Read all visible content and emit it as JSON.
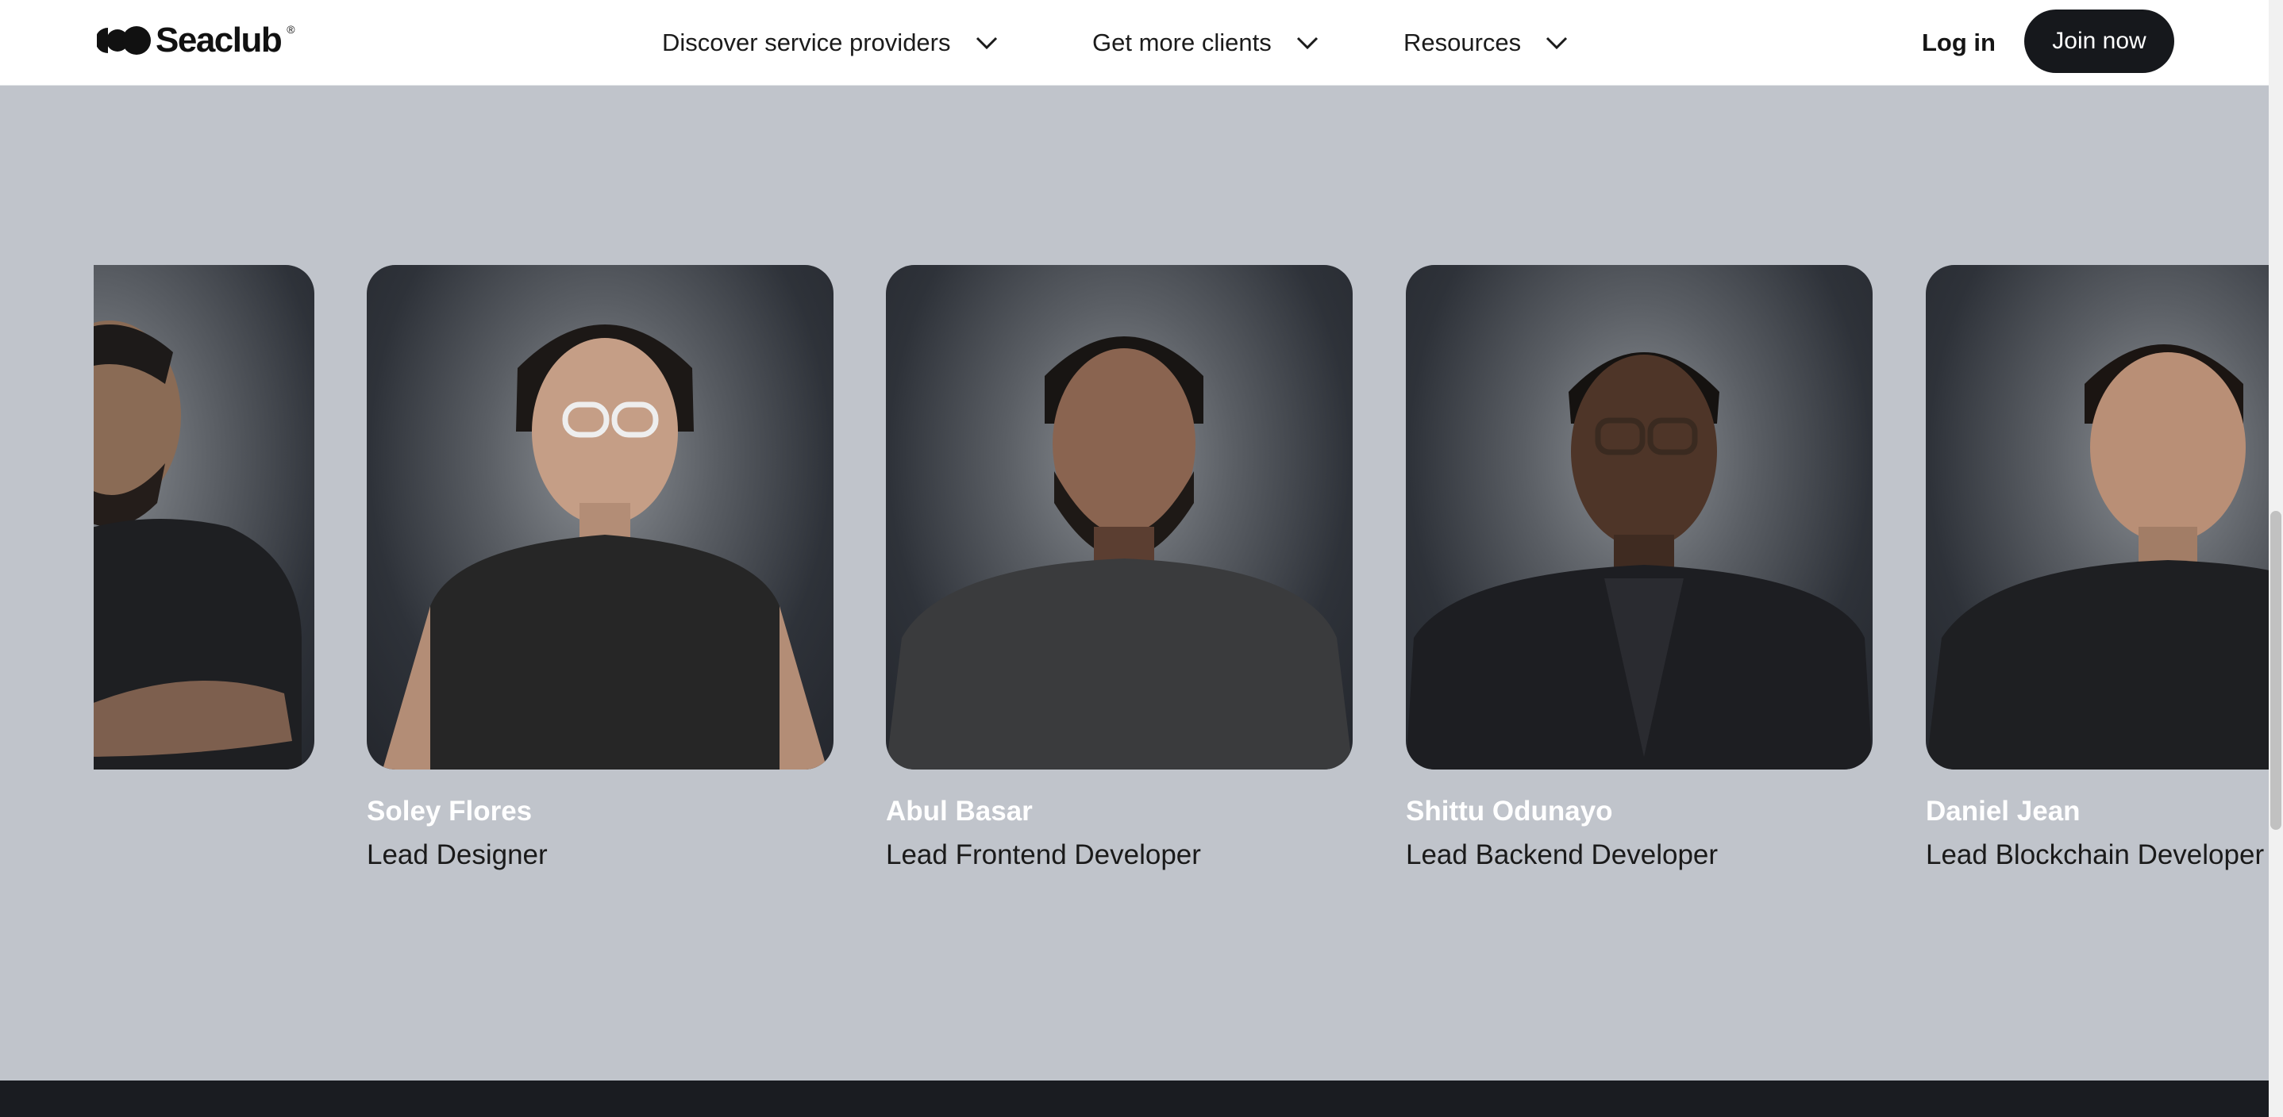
{
  "brand": {
    "name": "Seaclub",
    "registered": "®"
  },
  "nav": {
    "items": [
      {
        "label": "Discover service providers",
        "icon": "chevron-down-icon"
      },
      {
        "label": "Get more clients",
        "icon": "chevron-down-icon"
      },
      {
        "label": "Resources",
        "icon": "chevron-down-icon"
      }
    ],
    "login_label": "Log in",
    "join_label": "Join now"
  },
  "team": [
    {
      "name": "Soley Flores",
      "role": "Lead Designer"
    },
    {
      "name": "Abul Basar",
      "role": "Lead Frontend Developer"
    },
    {
      "name": "Shittu Odunayo",
      "role": "Lead Backend Developer"
    },
    {
      "name": "Daniel Jean",
      "role": "Lead Blockchain Developer"
    }
  ],
  "colors": {
    "page_background": "#c0c4cb",
    "nav_background": "#ffffff",
    "join_button": "#16181c",
    "name_text": "#ffffff",
    "role_text": "#1a1a1a",
    "footer": "#1a1c21"
  }
}
